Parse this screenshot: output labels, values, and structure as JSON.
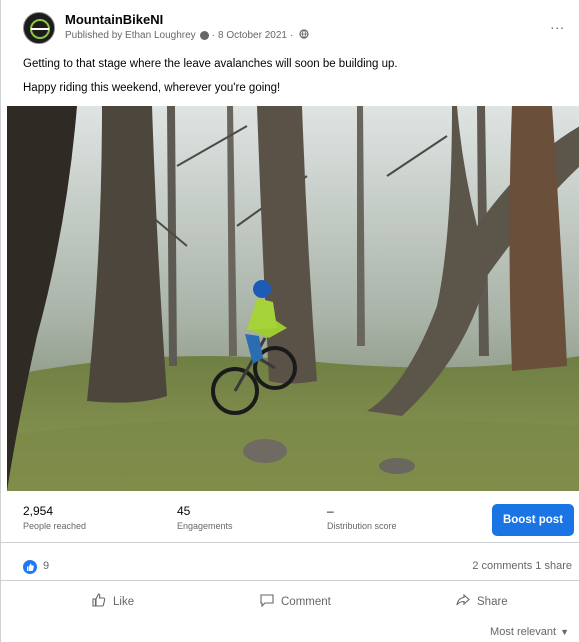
{
  "post": {
    "page_name": "MountainBikeNI",
    "published_by": "Published by Ethan Loughrey",
    "date": "8 October 2021",
    "text_line1": "Getting to that stage where the leave avalanches will soon be building up.",
    "text_line2": "Happy riding this weekend, wherever you're going!",
    "more_label": "...",
    "image_alt": "Mountain biker riding through a forest"
  },
  "stats": {
    "people_reached": "2,954",
    "people_reached_label": "People reached",
    "engagements": "45",
    "engagements_label": "Engagements",
    "distribution": "–",
    "distribution_label": "Distribution score",
    "boost_label": "Boost post"
  },
  "reactions": {
    "count": "9",
    "comments": "2 comments",
    "shares": "1 share"
  },
  "actions": {
    "like": "Like",
    "comment": "Comment",
    "share": "Share"
  },
  "sort": {
    "label": "Most relevant"
  },
  "colors": {
    "accent": "#1b74e4",
    "secondary_text": "#65676b"
  }
}
